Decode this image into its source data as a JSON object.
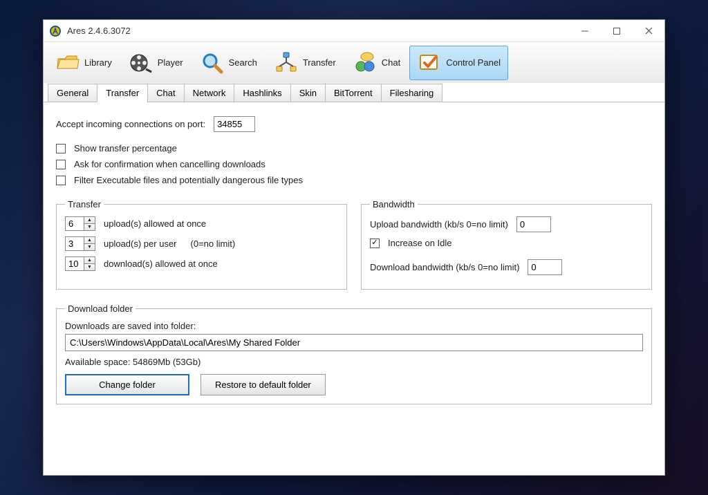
{
  "window": {
    "title": "Ares 2.4.6.3072"
  },
  "toolbar": {
    "library": "Library",
    "player": "Player",
    "search": "Search",
    "transfer": "Transfer",
    "chat": "Chat",
    "control_panel": "Control Panel"
  },
  "tabs": {
    "general": "General",
    "transfer": "Transfer",
    "chat": "Chat",
    "network": "Network",
    "hashlinks": "Hashlinks",
    "skin": "Skin",
    "bittorrent": "BitTorrent",
    "filesharing": "Filesharing"
  },
  "port": {
    "label": "Accept incoming connections on port:",
    "value": "34855"
  },
  "checks": {
    "show_pct": "Show transfer percentage",
    "ask_confirm": "Ask for confirmation when cancelling downloads",
    "filter_exe": "Filter Executable files and potentially dangerous file types",
    "increase_idle": "Increase on Idle"
  },
  "transfer_group": {
    "legend": "Transfer",
    "uploads_at_once": {
      "value": "6",
      "label": "upload(s) allowed at once"
    },
    "uploads_per_user": {
      "value": "3",
      "label": "upload(s) per user",
      "note": "(0=no limit)"
    },
    "downloads_at_once": {
      "value": "10",
      "label": "download(s) allowed at once"
    }
  },
  "bandwidth_group": {
    "legend": "Bandwidth",
    "upload_label": "Upload bandwidth (kb/s 0=no limit)",
    "upload_value": "0",
    "download_label": "Download bandwidth (kb/s 0=no limit)",
    "download_value": "0"
  },
  "download_folder": {
    "legend": "Download folder",
    "saved_label": "Downloads are saved into folder:",
    "path": "C:\\Users\\Windows\\AppData\\Local\\Ares\\My Shared Folder",
    "space": "Available space: 54869Mb (53Gb)",
    "change": "Change folder",
    "restore": "Restore to default folder"
  }
}
